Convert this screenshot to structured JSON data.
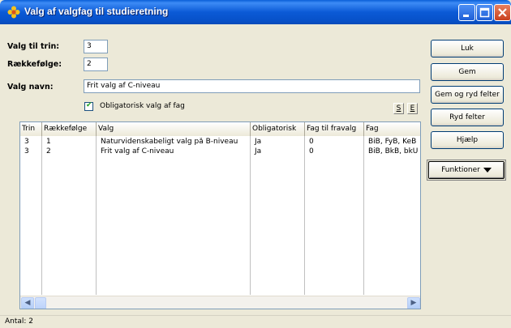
{
  "window": {
    "title": "Valg af valgfag til studieretning"
  },
  "form": {
    "trin_label": "Valg til trin:",
    "trin_value": "3",
    "raekkefolge_label": "Rækkefølge:",
    "raekkefolge_value": "2",
    "navn_label": "Valg navn:",
    "navn_value": "Frit valg af C-niveau",
    "obligatorisk_label": "Obligatorisk valg af fag",
    "obligatorisk_checked": "✔",
    "s_button": "S",
    "e_button": "E"
  },
  "grid": {
    "columns": [
      "Trin",
      "Rækkefølge",
      "Valg",
      "Obligatorisk",
      "Fag til fravalg",
      "Fag"
    ],
    "rows": [
      [
        "3",
        "1",
        "Naturvidenskabeligt valg på B-niveau",
        "Ja",
        "0",
        "BiB, FyB, KeB"
      ],
      [
        "3",
        "2",
        "Frit valg af C-niveau",
        "Ja",
        "0",
        "BiB, BkB, bkU"
      ]
    ],
    "scroll_left": "◀",
    "scroll_right": "▶"
  },
  "status": {
    "count_text": "Antal: 2"
  },
  "buttons": {
    "luk": "Luk",
    "gem": "Gem",
    "gem_ryd": "Gem og ryd felter",
    "ryd": "Ryd felter",
    "hjaelp": "Hjælp",
    "funktioner": "Funktioner"
  }
}
